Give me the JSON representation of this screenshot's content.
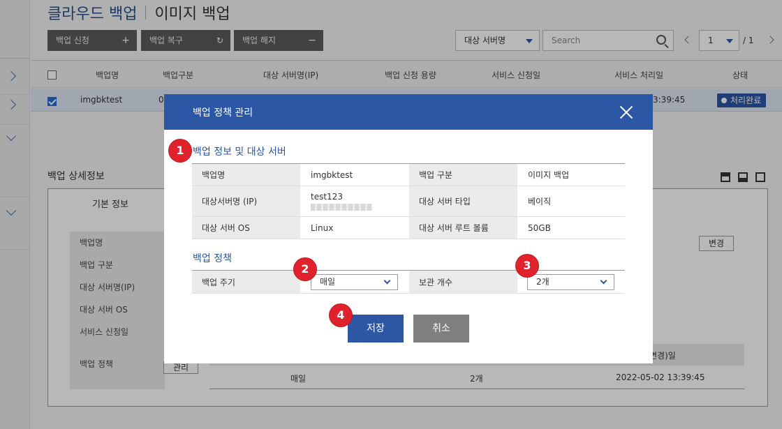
{
  "page": {
    "title": "클라우드 백업",
    "subtitle": "이미지 백업"
  },
  "toolbar": {
    "apply_label": "백업 신청",
    "restore_label": "백업 복구",
    "cancel_label": "백업 해지",
    "filter_value": "대상 서버명",
    "search_placeholder": "Search",
    "page_value": "1",
    "page_total": "/ 1"
  },
  "table": {
    "headers": [
      "백업명",
      "백업구분",
      "대상 서버명(IP)",
      "백업 신청 용량",
      "서비스 신청일",
      "서비스 처리일",
      "상태"
    ],
    "row": {
      "name": "imgbktest",
      "type_partial": "0",
      "processed_partial": "3:39:45",
      "status": "처리완료"
    }
  },
  "detail": {
    "title": "백업 상세정보",
    "tab": "기본 정보",
    "labels": [
      "백업명",
      "백업 구분",
      "대상 서버명(IP)",
      "대상 서버 OS",
      "서비스 신청일",
      "백업 정책"
    ],
    "change_label": "변경",
    "manage_label": "관리",
    "policy_header_partial": "변경)일",
    "policy_row": {
      "cycle": "매일",
      "count": "2개",
      "date": "2022-05-02 13:39:45"
    }
  },
  "modal": {
    "title": "백업 정책 관리",
    "section1_title": "백업 정보 및 대상 서버",
    "info": {
      "name_label": "백업명",
      "name_value": "imgbktest",
      "type_label": "백업 구분",
      "type_value": "이미지 백업",
      "server_label": "대상서버명 (IP)",
      "server_value": "test123",
      "server_type_label": "대상 서버 타입",
      "server_type_value": "베이직",
      "os_label": "대상 서버 OS",
      "os_value": "Linux",
      "root_label": "대상 서버 루트 볼륨",
      "root_value": "50GB"
    },
    "section2_title": "백업 정책",
    "policy": {
      "cycle_label": "백업 주기",
      "cycle_value": "매일",
      "count_label": "보관 개수",
      "count_value": "2개"
    },
    "save_label": "저장",
    "cancel_label": "취소"
  },
  "markers": [
    "1",
    "2",
    "3",
    "4"
  ],
  "colors": {
    "brand": "#2b57a5",
    "marker": "#e0222c"
  }
}
